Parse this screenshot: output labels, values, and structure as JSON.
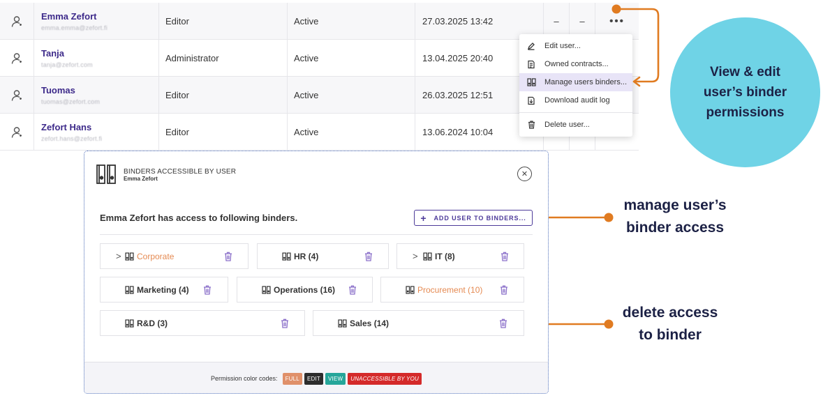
{
  "users": [
    {
      "name": "Emma Zefort",
      "email": "emma.emma@zefort.fi",
      "role": "Editor",
      "status": "Active",
      "last_login": "27.03.2025 13:42",
      "col1": "–",
      "col2": "–",
      "more": "•••"
    },
    {
      "name": "Tanja",
      "email": "tanja@zefort.com",
      "role": "Administrator",
      "status": "Active",
      "last_login": "13.04.2025 20:40"
    },
    {
      "name": "Tuomas",
      "email": "tuomas@zefort.com",
      "role": "Editor",
      "status": "Active",
      "last_login": "26.03.2025 12:51"
    },
    {
      "name": "Zefort Hans",
      "email": "zefort.hans@zefort.fi",
      "role": "Editor",
      "status": "Active",
      "last_login": "13.06.2024 10:04"
    }
  ],
  "user_menu": {
    "items": [
      {
        "label": "Edit user...",
        "icon": "pencil-icon"
      },
      {
        "label": "Owned contracts...",
        "icon": "contract-icon"
      },
      {
        "label": "Manage users binders...",
        "icon": "binder-icon",
        "active": true
      },
      {
        "label": "Download audit log",
        "icon": "download-log-icon"
      },
      {
        "label": "Delete user...",
        "icon": "trash-icon"
      }
    ]
  },
  "annotations": {
    "view_edit": "View & edit user’s binder permissions",
    "manage_line1": "manage user’s",
    "manage_line2": "binder access",
    "delete_line1": "delete access",
    "delete_line2": "to binder"
  },
  "modal": {
    "title": "BINDERS ACCESSIBLE BY USER",
    "subtitle": "Emma Zefort",
    "access_text": "Emma Zefort has access to following binders.",
    "add_button": "ADD USER TO BINDERS...",
    "close_icon": "close-icon",
    "binders": [
      {
        "label": "Corporate",
        "permission": "full",
        "expandable": true
      },
      {
        "label": "HR (4)",
        "permission": "edit"
      },
      {
        "label": "IT (8)",
        "permission": "edit",
        "expandable": true
      },
      {
        "label": "Marketing (4)",
        "permission": "edit"
      },
      {
        "label": "Operations (16)",
        "permission": "edit"
      },
      {
        "label": "Procurement (10)",
        "permission": "full"
      },
      {
        "label": "R&D (3)",
        "permission": "edit"
      },
      {
        "label": "Sales (14)",
        "permission": "edit"
      }
    ],
    "footer": {
      "label": "Permission color codes:",
      "badges": [
        {
          "text": "FULL",
          "color": "#e0906a"
        },
        {
          "text": "EDIT",
          "color": "#2d2d2d"
        },
        {
          "text": "VIEW",
          "color": "#26a69a"
        },
        {
          "text": "UNACCESSIBLE BY YOU",
          "color": "#d42a2a"
        }
      ]
    }
  },
  "colors": {
    "accent": "#4c3a99",
    "annotation_orange": "#e07b21",
    "circle": "#6fd3e6",
    "full_permission": "#e58a52"
  }
}
